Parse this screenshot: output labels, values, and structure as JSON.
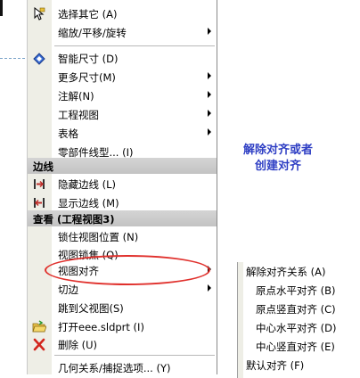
{
  "menu": {
    "items_top": [
      {
        "label": "选择其它 (A)",
        "icon": "select-other-icon",
        "arrow": false
      },
      {
        "label": "缩放/平移/旋转",
        "icon": "",
        "arrow": true
      },
      {
        "label": "智能尺寸 (D)",
        "icon": "smart-dimension-icon",
        "arrow": false
      },
      {
        "label": "更多尺寸(M)",
        "icon": "",
        "arrow": true
      },
      {
        "label": "注解(N)",
        "icon": "",
        "arrow": true
      },
      {
        "label": "工程视图",
        "icon": "",
        "arrow": true
      },
      {
        "label": "表格",
        "icon": "",
        "arrow": true
      },
      {
        "label": "零部件线型... (I)",
        "icon": "",
        "arrow": false
      }
    ],
    "section_edge": "边线",
    "items_edge": [
      {
        "label": "隐藏边线 (L)",
        "icon": "hide-edge-icon"
      },
      {
        "label": "显示边线 (M)",
        "icon": "show-edge-icon"
      }
    ],
    "section_view": "查看 (工程视图3)",
    "items_view": [
      {
        "label": "锁住视图位置 (N)",
        "icon": "",
        "arrow": false
      },
      {
        "label": "视图锁焦 (Q)",
        "icon": "",
        "arrow": false
      },
      {
        "label": "视图对齐",
        "icon": "",
        "arrow": true
      },
      {
        "label": "切边",
        "icon": "",
        "arrow": true
      },
      {
        "label": "跳到父视图(S)",
        "icon": "",
        "arrow": false
      },
      {
        "label": "打开eee.sldprt (I)",
        "icon": "open-folder-icon",
        "arrow": false
      },
      {
        "label": "删除 (U)",
        "icon": "delete-icon",
        "arrow": false
      },
      {
        "label": "几何关系/捕捉选项... (Y)",
        "icon": "",
        "arrow": false
      }
    ]
  },
  "submenu": {
    "items": [
      "解除对齐关系 (A)",
      "原点水平对齐 (B)",
      "原点竖直对齐 (C)",
      "中心水平对齐 (D)",
      "中心竖直对齐 (E)",
      "默认对齐 (F)"
    ]
  },
  "annotation": {
    "line1": "解除对齐或者",
    "line2": "创建对齐",
    "color": "#2f3fc4",
    "oval_color": "#e0302c"
  }
}
